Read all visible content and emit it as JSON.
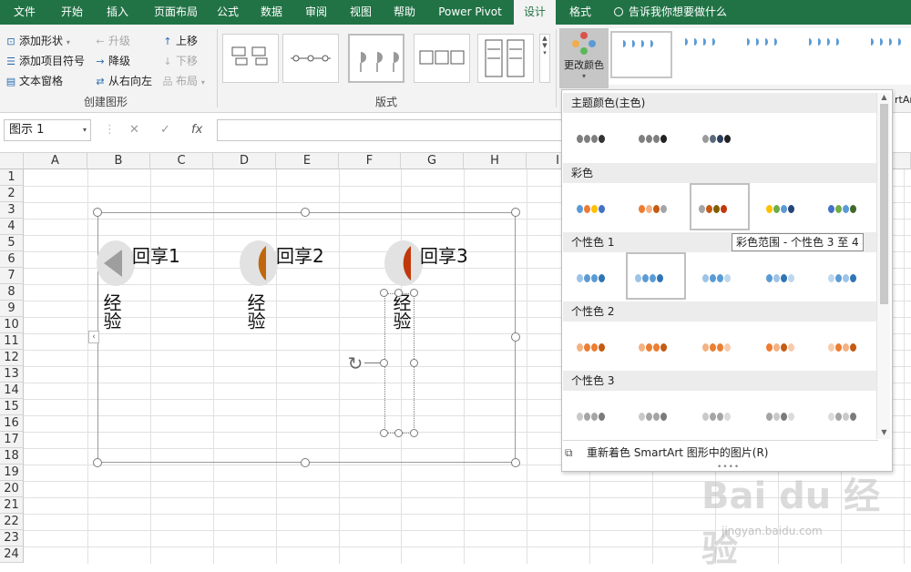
{
  "tabs": [
    "文件",
    "开始",
    "插入",
    "页面布局",
    "公式",
    "数据",
    "审阅",
    "视图",
    "帮助",
    "Power Pivot",
    "设计",
    "格式"
  ],
  "tell_me": "告诉我你想要做什么",
  "ribbon": {
    "create_graphic": {
      "add_shape": "添加形状",
      "promote": "升级",
      "move_up": "上移",
      "add_bullet": "添加项目符号",
      "demote": "降级",
      "move_down": "下移",
      "text_pane": "文本窗格",
      "right_to_left": "从右向左",
      "layout": "布局",
      "group_label": "创建图形"
    },
    "layouts_label": "版式",
    "change_colors": "更改颜色",
    "smartart_cut": "rtAr"
  },
  "formula_bar": {
    "name_box": "图示 1",
    "cancel": "✕",
    "confirm": "✓",
    "fx": "fx"
  },
  "columns": [
    "A",
    "B",
    "C",
    "D",
    "E",
    "F",
    "G",
    "H",
    "I"
  ],
  "rows": [
    "1",
    "2",
    "3",
    "4",
    "5",
    "6",
    "7",
    "8",
    "9",
    "10",
    "11",
    "12",
    "13",
    "14",
    "15",
    "16",
    "17",
    "18",
    "19",
    "20",
    "21",
    "22",
    "23",
    "24"
  ],
  "smartart": {
    "nodes": [
      {
        "title": "回享1",
        "text": "经验",
        "color": "#9e9e9e"
      },
      {
        "title": "回享2",
        "text": "经验",
        "color": "#c0670d"
      },
      {
        "title": "回享3",
        "text": "经验",
        "color": "#c0380c"
      }
    ]
  },
  "color_dropdown": {
    "sections": [
      "主题颜色(主色)",
      "彩色",
      "个性色 1",
      "个性色 2",
      "个性色 3"
    ],
    "tooltip": "彩色范围 - 个性色 3 至 4",
    "footer": "重新着色 SmartArt 图形中的图片(R)"
  },
  "watermark": {
    "logo": "Bai du 经验",
    "url": "jingyan.baidu.com"
  }
}
